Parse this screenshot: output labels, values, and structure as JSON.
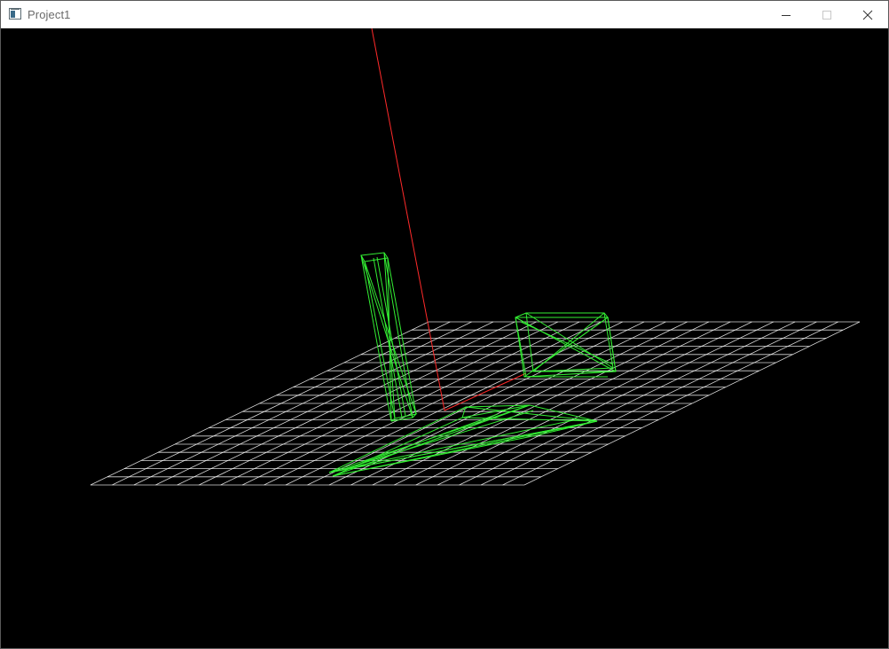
{
  "window": {
    "title": "Project1",
    "controls": {
      "minimize_icon": "minimize-icon",
      "maximize_icon": "maximize-icon",
      "close_icon": "close-icon"
    }
  },
  "viewport": {
    "background": "#000000",
    "grid_color": "#ffffff",
    "axis_color": "#ff0000",
    "mesh_color": "#33ff33",
    "grid_divisions": 10
  }
}
